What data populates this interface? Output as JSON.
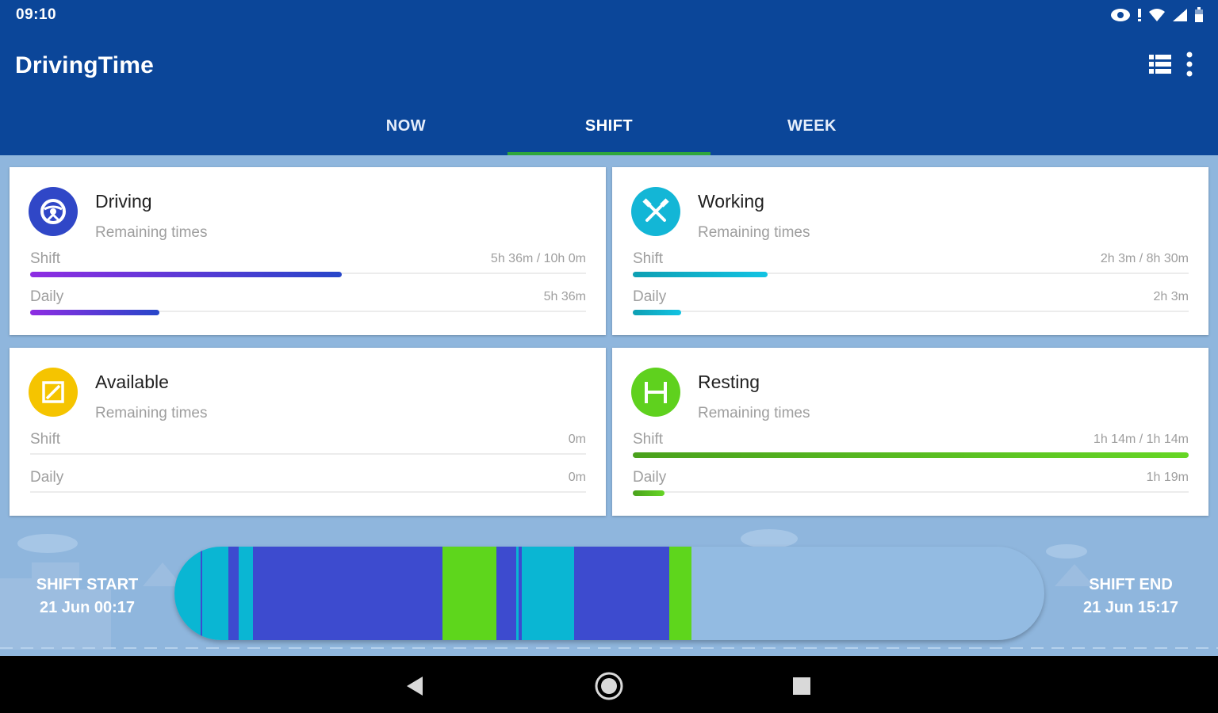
{
  "status_bar": {
    "time": "09:10",
    "icons": [
      "eye-icon",
      "alert-icon",
      "wifi-icon",
      "signal-icon",
      "battery-icon"
    ]
  },
  "app": {
    "title": "DrivingTime",
    "actions": [
      "list-view-icon",
      "more-vert-icon"
    ]
  },
  "tabs": [
    {
      "label": "NOW",
      "active": false
    },
    {
      "label": "SHIFT",
      "active": true
    },
    {
      "label": "WEEK",
      "active": false
    }
  ],
  "cards": [
    {
      "name": "driving",
      "title": "Driving",
      "subtitle": "Remaining times",
      "icon": "steering-wheel-icon",
      "icon_color": "#3047c7",
      "rows": [
        {
          "label": "Shift",
          "value": "5h 36m / 10h 0m",
          "progress": 0.56,
          "gradient": [
            "#8e2de2",
            "#2746c9"
          ]
        },
        {
          "label": "Daily",
          "value": "5h 36m",
          "progress": 0.233,
          "gradient": [
            "#8e2de2",
            "#2746c9"
          ]
        }
      ]
    },
    {
      "name": "working",
      "title": "Working",
      "subtitle": "Remaining times",
      "icon": "crossed-hammers-icon",
      "icon_color": "#13b6d6",
      "rows": [
        {
          "label": "Shift",
          "value": "2h 3m / 8h 30m",
          "progress": 0.242,
          "gradient": [
            "#0e9fb3",
            "#12c3e3"
          ]
        },
        {
          "label": "Daily",
          "value": "2h 3m",
          "progress": 0.087,
          "gradient": [
            "#0e9fb3",
            "#12c3e3"
          ]
        }
      ]
    },
    {
      "name": "available",
      "title": "Available",
      "subtitle": "Remaining times",
      "icon": "available-square-icon",
      "icon_color": "#f5c400",
      "rows": [
        {
          "label": "Shift",
          "value": "0m",
          "progress": 0,
          "gradient": [
            "#f5c400",
            "#f5c400"
          ]
        },
        {
          "label": "Daily",
          "value": "0m",
          "progress": 0,
          "gradient": [
            "#f5c400",
            "#f5c400"
          ]
        }
      ]
    },
    {
      "name": "resting",
      "title": "Resting",
      "subtitle": "Remaining times",
      "icon": "bed-icon",
      "icon_color": "#5fd11e",
      "rows": [
        {
          "label": "Shift",
          "value": "1h 14m / 1h 14m",
          "progress": 1.0,
          "gradient": [
            "#4aa11c",
            "#66d625"
          ]
        },
        {
          "label": "Daily",
          "value": "1h 19m",
          "progress": 0.057,
          "gradient": [
            "#4aa11c",
            "#66d625"
          ]
        }
      ]
    }
  ],
  "shift": {
    "start_label": "SHIFT START",
    "start_time": "21 Jun 00:17",
    "end_label": "SHIFT END",
    "end_time": "21 Jun 15:17",
    "timeline_colors": {
      "driving": "#3d4bcf",
      "working": "#0ab6d3",
      "resting": "#5ed61c",
      "remaining": "#93bbe2"
    },
    "timeline_segments": [
      {
        "type": "working",
        "start": 0.0,
        "end": 0.03
      },
      {
        "type": "driving",
        "start": 0.03,
        "end": 0.032
      },
      {
        "type": "working",
        "start": 0.032,
        "end": 0.062
      },
      {
        "type": "driving",
        "start": 0.062,
        "end": 0.074
      },
      {
        "type": "working",
        "start": 0.074,
        "end": 0.09
      },
      {
        "type": "driving",
        "start": 0.09,
        "end": 0.308
      },
      {
        "type": "resting",
        "start": 0.308,
        "end": 0.37
      },
      {
        "type": "driving",
        "start": 0.37,
        "end": 0.393
      },
      {
        "type": "working",
        "start": 0.393,
        "end": 0.396
      },
      {
        "type": "driving",
        "start": 0.396,
        "end": 0.399
      },
      {
        "type": "working",
        "start": 0.399,
        "end": 0.459
      },
      {
        "type": "driving",
        "start": 0.459,
        "end": 0.569
      },
      {
        "type": "resting",
        "start": 0.569,
        "end": 0.594
      }
    ]
  },
  "nav": [
    "back-icon",
    "home-icon",
    "recents-icon"
  ]
}
